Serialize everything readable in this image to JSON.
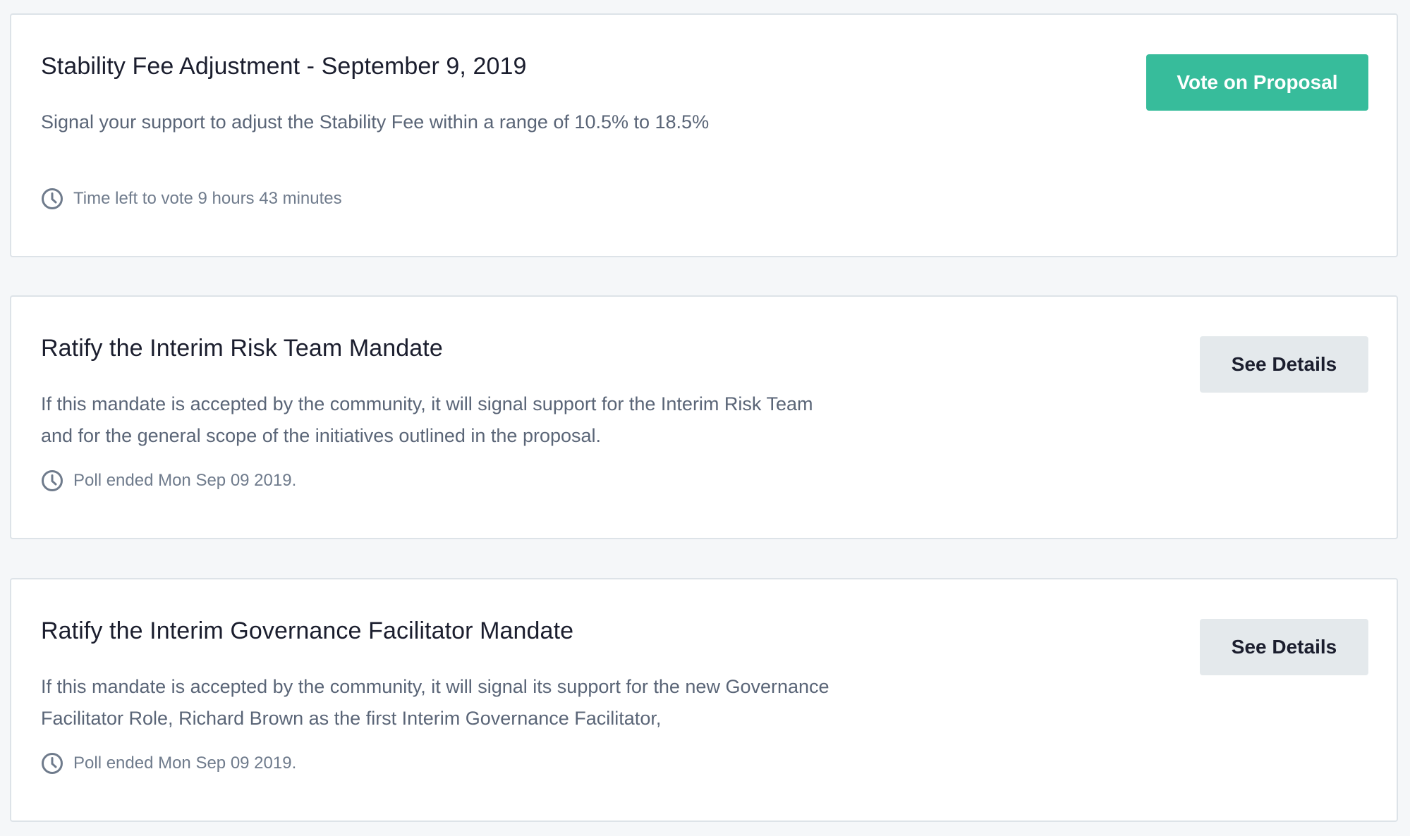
{
  "polls": [
    {
      "title": "Stability Fee Adjustment - September 9, 2019",
      "description": "Signal your support to adjust the Stability Fee within a range of 10.5% to 18.5%",
      "status": "Time left to vote 9 hours 43 minutes",
      "status_icon": "clock-icon",
      "button_label": "Vote on Proposal"
    },
    {
      "title": "Ratify the Interim Risk Team Mandate",
      "description": "If this mandate is accepted by the community, it will signal support for the Interim Risk Team and for the general scope of the initiatives outlined in the proposal.",
      "status": "Poll ended Mon Sep 09 2019.",
      "status_icon": "clock-icon",
      "button_label": "See Details"
    },
    {
      "title": "Ratify the Interim Governance Facilitator Mandate",
      "description": "If this mandate is accepted by the community, it will signal its support for the new Governance Facilitator Role, Richard Brown as the first Interim Governance Facilitator,",
      "status": "Poll ended Mon Sep 09 2019.",
      "status_icon": "clock-icon",
      "button_label": "See Details"
    }
  ],
  "colors": {
    "background": "#f5f7f9",
    "card": "#ffffff",
    "card_border": "#dde3e8",
    "primary_button": "#37bc9b",
    "secondary_button": "#e4e9ec",
    "title_text": "#1b1e2e",
    "body_text": "#5a6577",
    "meta_text": "#6f7b8c"
  }
}
